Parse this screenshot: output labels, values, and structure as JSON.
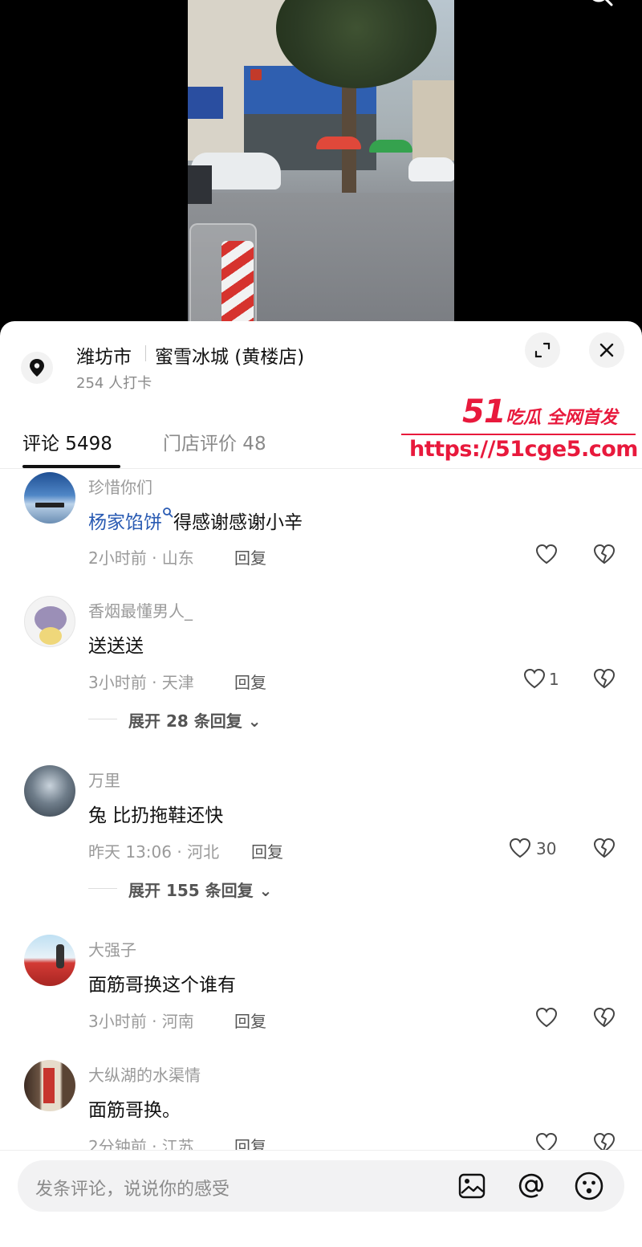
{
  "header": {
    "city": "潍坊市",
    "store": "蜜雪冰城 (黄楼店)",
    "checkin": "254 人打卡"
  },
  "tabs": {
    "comments": "评论 5498",
    "reviews": "门店评价 48"
  },
  "watermark": {
    "brand": "51",
    "slogan": "吃瓜 全网首发",
    "url": "https://51cge5.com"
  },
  "comments": [
    {
      "user": "珍惜你们",
      "link_text": "杨家馅饼",
      "text": "得感谢感谢小辛",
      "meta": "2小时前 · 山东",
      "reply": "回复",
      "likes": ""
    },
    {
      "user": "香烟最懂男人_",
      "text": "送送送",
      "meta": "3小时前 · 天津",
      "reply": "回复",
      "likes": "1",
      "expand": "展开 28 条回复"
    },
    {
      "user": "万里",
      "text": "兔 比扔拖鞋还快",
      "meta": "昨天 13:06 · 河北",
      "reply": "回复",
      "likes": "30",
      "expand": "展开 155 条回复"
    },
    {
      "user": "大强子",
      "text": "面筋哥换这个谁有",
      "meta": "3小时前 · 河南",
      "reply": "回复",
      "likes": ""
    },
    {
      "user": "大纵湖的水渠情",
      "text": "面筋哥换。",
      "meta": "2分钟前 · 江苏",
      "reply": "回复",
      "likes": ""
    }
  ],
  "input": {
    "placeholder": "发条评论，说说你的感受"
  },
  "colors": {
    "watermark": "#e8193c",
    "link": "#2a5bb3"
  }
}
